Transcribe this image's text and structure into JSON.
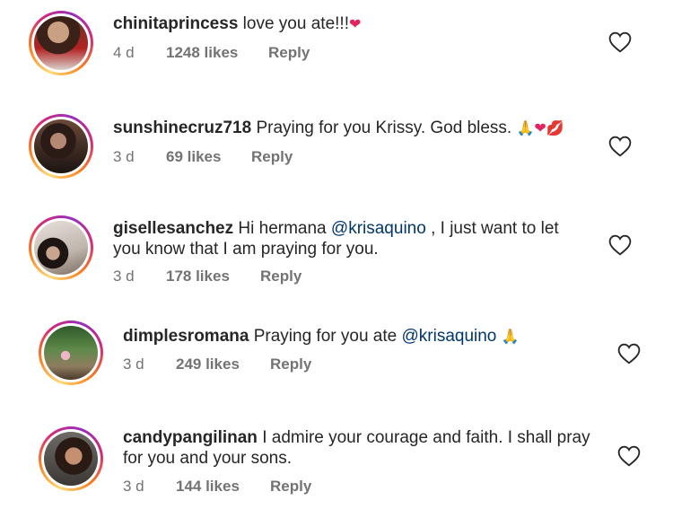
{
  "comments": [
    {
      "username": "chinitaprincess",
      "text_parts": [
        "love you ate!!!"
      ],
      "mention": "",
      "emoji": "❤",
      "age": "4 d",
      "likes": "1248 likes",
      "reply": "Reply",
      "avatar": "avatar-woman-red-jacket"
    },
    {
      "username": "sunshinecruz718",
      "text_parts": [
        "Praying for you Krissy. God bless."
      ],
      "mention": "",
      "emoji": "🙏❤💋",
      "age": "3 d",
      "likes": "69 likes",
      "reply": "Reply",
      "avatar": "avatar-woman-dark"
    },
    {
      "username": "gisellesanchez",
      "text_parts": [
        "Hi hermana",
        ", I just want to let",
        "you know that I am praying for you."
      ],
      "mention": "@krisaquino",
      "emoji": "",
      "age": "3 d",
      "likes": "178 likes",
      "reply": "Reply",
      "avatar": "avatar-woman-lying"
    },
    {
      "username": "dimplesromana",
      "text_parts": [
        "Praying for you ate"
      ],
      "mention": "@krisaquino",
      "emoji": "🙏",
      "age": "3 d",
      "likes": "249 likes",
      "reply": "Reply",
      "avatar": "avatar-garden"
    },
    {
      "username": "candypangilinan",
      "text_parts": [
        "I admire your courage and faith. I shall pray",
        "for you and your sons."
      ],
      "mention": "",
      "emoji": "",
      "age": "3 d",
      "likes": "144 likes",
      "reply": "Reply",
      "avatar": "avatar-woman-portrait"
    }
  ],
  "icons": {
    "like": "heart-outline-icon"
  },
  "colors": {
    "text": "#262626",
    "meta": "#737373",
    "mention": "#00376b",
    "emoji_heart": "#e0245e"
  }
}
